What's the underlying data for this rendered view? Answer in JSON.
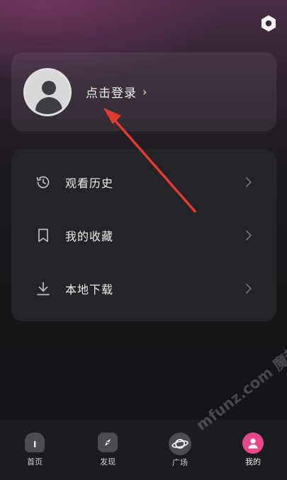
{
  "login": {
    "label": "点击登录",
    "chevron": "›"
  },
  "menu": {
    "items": [
      {
        "label": "观看历史",
        "icon": "history-icon"
      },
      {
        "label": "我的收藏",
        "icon": "bookmark-icon"
      },
      {
        "label": "本地下载",
        "icon": "download-icon"
      }
    ]
  },
  "bottom_nav": {
    "tabs": [
      {
        "label": "首页",
        "icon": "home-icon"
      },
      {
        "label": "发现",
        "icon": "compass-icon"
      },
      {
        "label": "广场",
        "icon": "planet-icon"
      },
      {
        "label": "我的",
        "icon": "profile-icon",
        "active": true
      }
    ]
  },
  "watermark": "mfunz.com 魔趣网",
  "colors": {
    "accent": "#e8478b",
    "annotation_arrow": "#e53a2f",
    "card": "#242327",
    "background": "#161518"
  }
}
